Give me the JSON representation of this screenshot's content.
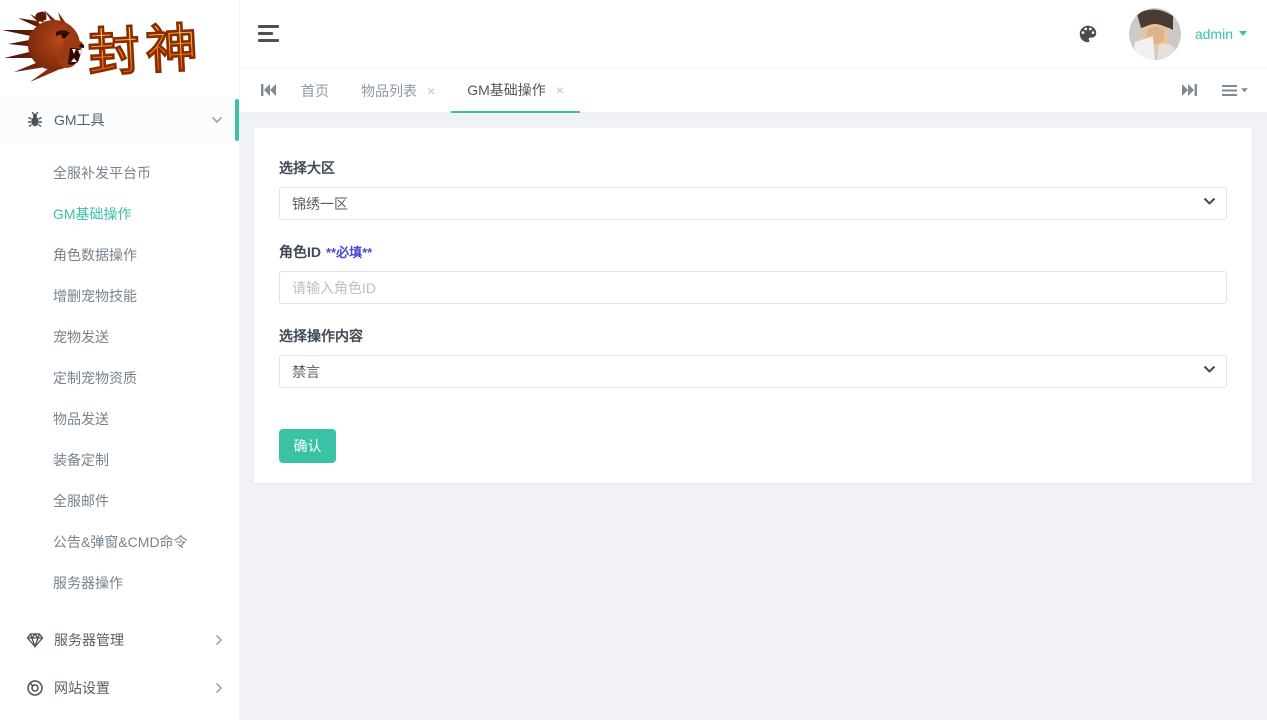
{
  "colors": {
    "accent": "#3ac2a6",
    "required_note": "#4a4ad0",
    "button": "#3ac2a6"
  },
  "logo": {
    "title": "封神",
    "icon": "lion-icon"
  },
  "topbar": {
    "username": "admin",
    "icons": {
      "menu": "hamburger-icon",
      "theme": "palette-icon",
      "avatar": "user-avatar",
      "user_caret": "caret-down-icon"
    }
  },
  "tabbar": {
    "icons": {
      "scroll_left": "skip-backward-icon",
      "scroll_right": "skip-forward-icon",
      "list_menu": "list-caret-icon",
      "close_glyph": "×"
    },
    "tabs": [
      {
        "label": "首页",
        "closable": false,
        "active": false
      },
      {
        "label": "物品列表",
        "closable": true,
        "active": false
      },
      {
        "label": "GM基础操作",
        "closable": true,
        "active": true
      }
    ]
  },
  "sidebar": {
    "sections": [
      {
        "label": "GM工具",
        "icon": "bug-icon",
        "expanded": true,
        "active_item": "GM基础操作",
        "items": [
          "全服补发平台币",
          "GM基础操作",
          "角色数据操作",
          "增删宠物技能",
          "宠物发送",
          "定制宠物资质",
          "物品发送",
          "装备定制",
          "全服邮件",
          "公告&弹窗&CMD命令",
          "服务器操作"
        ]
      },
      {
        "label": "服务器管理",
        "icon": "gem-icon",
        "expanded": false
      },
      {
        "label": "网站设置",
        "icon": "globe-icon",
        "expanded": false
      }
    ]
  },
  "form": {
    "region_label": "选择大区",
    "region_value": "锦绣一区",
    "role_label": "角色ID",
    "role_required": "**必填**",
    "role_placeholder": "请输入角色ID",
    "action_label": "选择操作内容",
    "action_value": "禁言",
    "submit_label": "确认"
  }
}
